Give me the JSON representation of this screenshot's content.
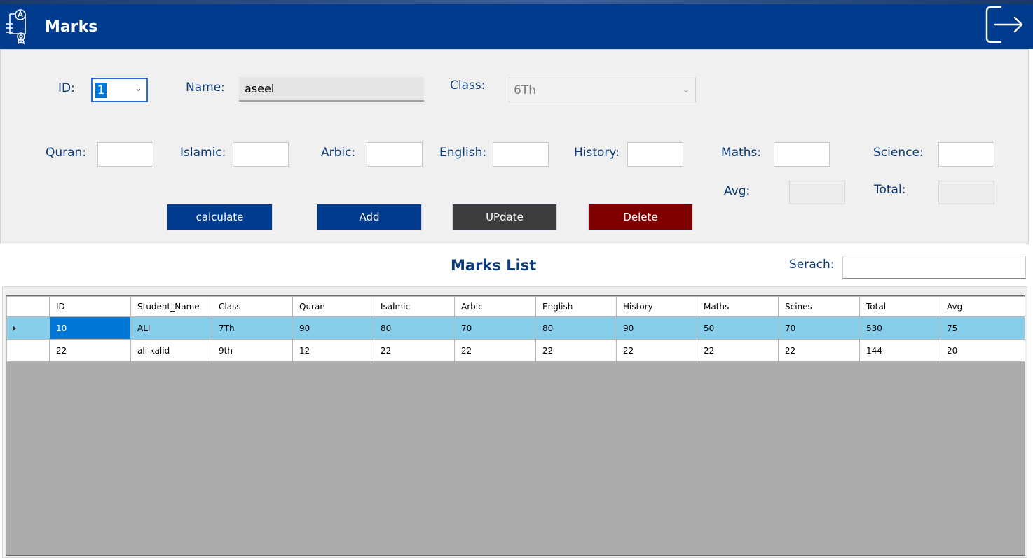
{
  "header": {
    "title": "Marks"
  },
  "form": {
    "id_label": "ID:",
    "id_value": "1",
    "name_label": "Name:",
    "name_value": "aseel",
    "class_label": "Class:",
    "class_value": "6Th",
    "subjects": [
      {
        "label": "Quran:",
        "key": "quran"
      },
      {
        "label": "Islamic:",
        "key": "islamic"
      },
      {
        "label": "Arbic:",
        "key": "arbic"
      },
      {
        "label": "English:",
        "key": "english"
      },
      {
        "label": "History:",
        "key": "history"
      },
      {
        "label": "Maths:",
        "key": "maths"
      },
      {
        "label": "Science:",
        "key": "science"
      }
    ],
    "avg_label": "Avg:",
    "total_label": "Total:"
  },
  "buttons": {
    "calculate": "calculate",
    "add": "Add",
    "update": "UPdate",
    "delete": "Delete"
  },
  "list": {
    "title": "Marks List",
    "search_label": "Serach:"
  },
  "table": {
    "columns": [
      "ID",
      "Student_Name",
      "Class",
      "Quran",
      "Isalmic",
      "Arbic",
      "English",
      "History",
      "Maths",
      "Scines",
      "Total",
      "Avg"
    ],
    "rows": [
      [
        "10",
        "ALI",
        "7Th",
        "90",
        "80",
        "70",
        "80",
        "90",
        "50",
        "70",
        "530",
        "75"
      ],
      [
        "22",
        "ali kalid",
        "9th",
        "12",
        "22",
        "22",
        "22",
        "22",
        "22",
        "22",
        "144",
        "20"
      ]
    ]
  },
  "colors": {
    "header_bg": "#003b8e",
    "label_text": "#0b3a78",
    "update_btn": "#3c3c3c",
    "delete_btn": "#7f0000",
    "selected_row": "#87ceeb",
    "grid_empty": "#ababab"
  },
  "icons": {
    "logo": "certificate-icon",
    "logout": "logout-icon",
    "row_indicator": "row-arrow-icon"
  }
}
